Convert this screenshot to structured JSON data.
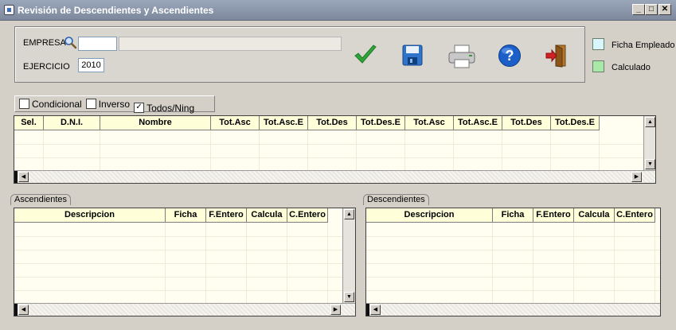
{
  "window": {
    "title": "Revisión de Descendientes y Ascendientes",
    "minimize": "_",
    "maximize": "□",
    "close": "✕"
  },
  "form": {
    "empresa_label": "EMPRESA",
    "empresa_code": "",
    "empresa_name": "",
    "ejercicio_label": "EJERCICIO",
    "ejercicio_value": "2010"
  },
  "legend": {
    "ficha_label": "Ficha Empleado",
    "ficha_color": "#d8f6fb",
    "calculado_label": "Calculado",
    "calculado_color": "#a8e8a8"
  },
  "filters": [
    {
      "label": "Condicional",
      "checked": false
    },
    {
      "label": "Inverso",
      "checked": false
    },
    {
      "label": "Todos/Ning",
      "checked": true
    }
  ],
  "main_grid": {
    "columns": [
      "Sel.",
      "D.N.I.",
      "Nombre",
      "Tot.Asc",
      "Tot.Asc.E",
      "Tot.Des",
      "Tot.Des.E",
      "Tot.Asc",
      "Tot.Asc.E",
      "Tot.Des",
      "Tot.Des.E"
    ]
  },
  "ascendientes": {
    "title": "Ascendientes",
    "columns": [
      "Descripcion",
      "Ficha",
      "F.Entero",
      "Calcula",
      "C.Entero"
    ]
  },
  "descendientes": {
    "title": "Descendientes",
    "columns": [
      "Descripcion",
      "Ficha",
      "F.Entero",
      "Calcula",
      "C.Entero"
    ]
  },
  "colors": {
    "title_bar": "#8a95aa",
    "grid_background": "#fffef0",
    "grid_header": "#fefed9"
  }
}
